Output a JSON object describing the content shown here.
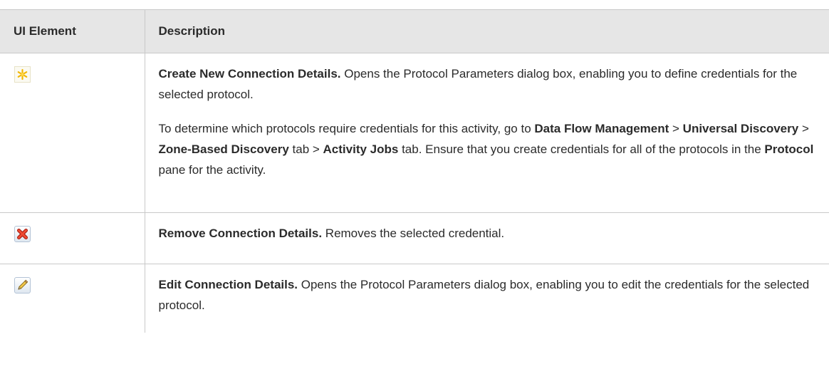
{
  "header": {
    "col_element": "UI Element",
    "col_description": "Description"
  },
  "rows": [
    {
      "icon": "new-connection-star-icon",
      "lead": "Create New Connection Details.",
      "text": " Opens the Protocol Parameters dialog box, enabling you to define credentials for the selected protocol.",
      "note": {
        "t1": "To determine which protocols require credentials for this activity, go to ",
        "b1": "Data Flow Management",
        "t2": " > ",
        "b2": "Universal Discovery",
        "t3": " > ",
        "b3": "Zone-Based Discovery",
        "t4": " tab > ",
        "b4": "Activity Jobs",
        "t5": " tab. Ensure that you create credentials for all of the protocols in the ",
        "b5": "Protocol",
        "t6": " pane for the activity."
      }
    },
    {
      "icon": "remove-x-icon",
      "lead": "Remove Connection Details.",
      "text": " Removes the selected credential."
    },
    {
      "icon": "edit-pencil-icon",
      "lead": "Edit Connection Details.",
      "text": " Opens the Protocol Parameters dialog box, enabling you to edit the credentials for the selected protocol."
    }
  ]
}
